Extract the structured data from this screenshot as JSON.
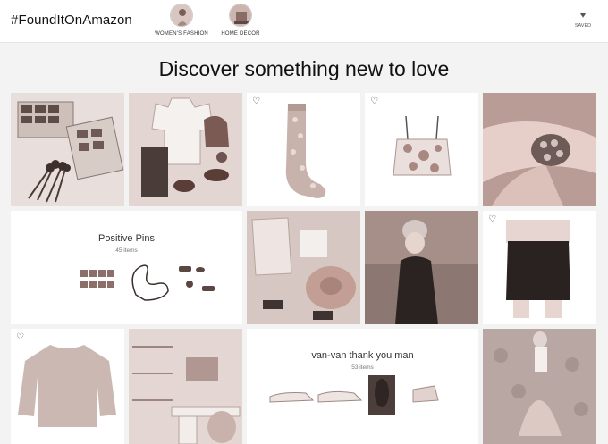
{
  "header": {
    "brand": "#FoundItOnAmazon",
    "nav": [
      {
        "label": "WOMEN'S FASHION",
        "icon": "womens-fashion-thumbnail"
      },
      {
        "label": "HOME DECOR",
        "icon": "home-decor-thumbnail"
      }
    ],
    "saved_label": "SAVED",
    "saved_icon": "heart-icon"
  },
  "main": {
    "headline": "Discover something new to love",
    "collections": [
      {
        "title": "Positive Pins",
        "count": "45 items"
      },
      {
        "title": "van-van thank you man",
        "count": "53 items"
      }
    ]
  },
  "colors": {
    "accent": "#111111",
    "photo_tint": "#c8b2ac",
    "background": "#f3f3f3"
  }
}
